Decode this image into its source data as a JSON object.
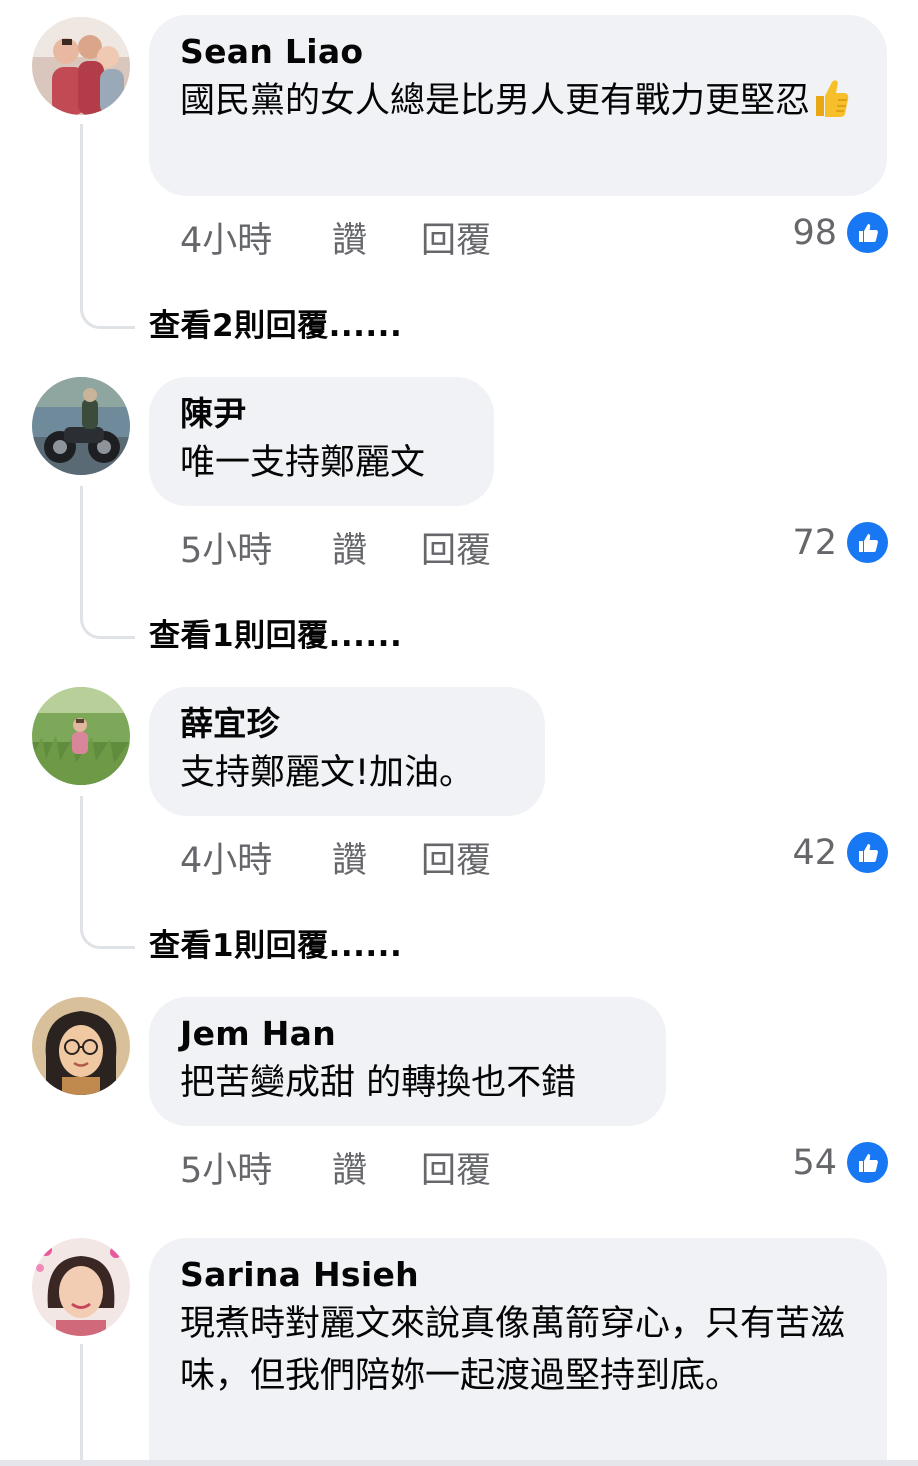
{
  "comments": [
    {
      "author": "Sean Liao",
      "text": "國民黨的女人總是比男人更有戰力更堅忍",
      "emoji": "thumbs-up",
      "time": "4小時",
      "like_label": "讚",
      "reply_label": "回覆",
      "reaction_count": "98",
      "view_replies": "查看2則回覆......"
    },
    {
      "author": "陳尹",
      "text": "唯一支持鄭麗文",
      "time": "5小時",
      "like_label": "讚",
      "reply_label": "回覆",
      "reaction_count": "72",
      "view_replies": "查看1則回覆......"
    },
    {
      "author": "薛宜珍",
      "text": "支持鄭麗文!加油。",
      "time": "4小時",
      "like_label": "讚",
      "reply_label": "回覆",
      "reaction_count": "42",
      "view_replies": "查看1則回覆......"
    },
    {
      "author": "Jem  Han",
      "text": "把苦變成甜 的轉換也不錯",
      "time": "5小時",
      "like_label": "讚",
      "reply_label": "回覆",
      "reaction_count": "54"
    },
    {
      "author": "Sarina  Hsieh",
      "text": "現煮時對麗文來說真像萬箭穿心，只有苦滋味，但我們陪妳一起渡過堅持到底。"
    }
  ],
  "colors": {
    "bubble": "#f0f2f5",
    "meta_text": "#65676b",
    "like_blue": "#1877f2",
    "thread_line": "#dfe2e6"
  }
}
